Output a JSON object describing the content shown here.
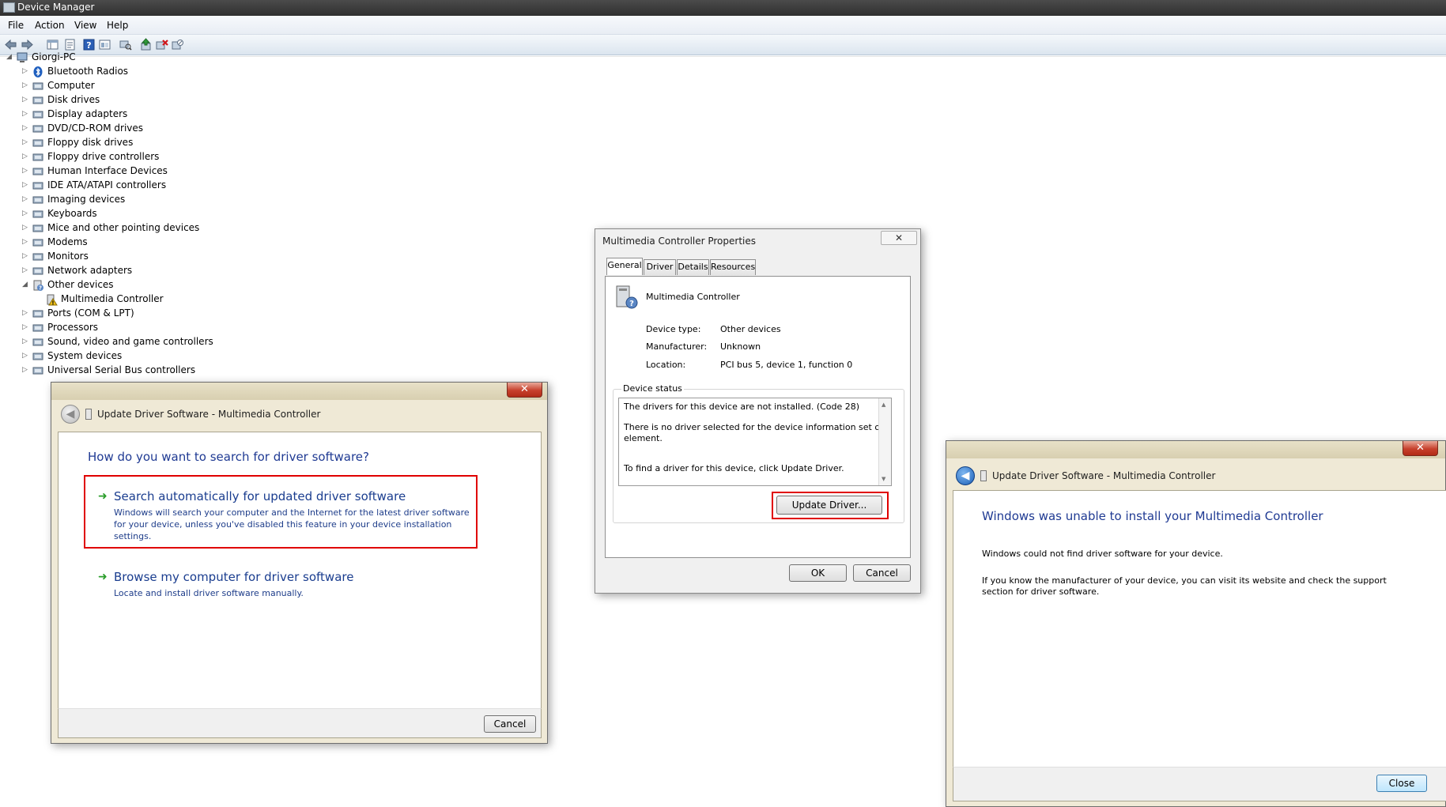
{
  "window": {
    "title": "Device Manager"
  },
  "menu": {
    "items": [
      "File",
      "Action",
      "View",
      "Help"
    ]
  },
  "toolbar": {
    "icons": [
      "back-arrow-icon",
      "forward-arrow-icon",
      "show-hide-console-tree-icon",
      "properties-icon",
      "help-icon",
      "console-view-icon",
      "scan-hardware-icon",
      "update-driver-icon",
      "uninstall-icon",
      "disable-icon"
    ]
  },
  "tree": {
    "root": "Giorgi-PC",
    "items": [
      {
        "label": "Bluetooth Radios",
        "icon": "bluetooth-icon"
      },
      {
        "label": "Computer",
        "icon": "computer-icon"
      },
      {
        "label": "Disk drives",
        "icon": "disk-drive-icon"
      },
      {
        "label": "Display adapters",
        "icon": "display-adapter-icon"
      },
      {
        "label": "DVD/CD-ROM drives",
        "icon": "dvd-drive-icon"
      },
      {
        "label": "Floppy disk drives",
        "icon": "floppy-disk-icon"
      },
      {
        "label": "Floppy drive controllers",
        "icon": "floppy-controller-icon"
      },
      {
        "label": "Human Interface Devices",
        "icon": "hid-icon"
      },
      {
        "label": "IDE ATA/ATAPI controllers",
        "icon": "ide-controller-icon"
      },
      {
        "label": "Imaging devices",
        "icon": "imaging-device-icon"
      },
      {
        "label": "Keyboards",
        "icon": "keyboard-icon"
      },
      {
        "label": "Mice and other pointing devices",
        "icon": "mouse-icon"
      },
      {
        "label": "Modems",
        "icon": "modem-icon"
      },
      {
        "label": "Monitors",
        "icon": "monitor-icon"
      },
      {
        "label": "Network adapters",
        "icon": "network-adapter-icon"
      },
      {
        "label": "Other devices",
        "icon": "other-devices-icon"
      },
      {
        "label": "Multimedia Controller",
        "icon": "unknown-device-warning-icon"
      },
      {
        "label": "Ports (COM & LPT)",
        "icon": "port-icon"
      },
      {
        "label": "Processors",
        "icon": "processor-icon"
      },
      {
        "label": "Sound, video and game controllers",
        "icon": "sound-icon"
      },
      {
        "label": "System devices",
        "icon": "system-device-icon"
      },
      {
        "label": "Universal Serial Bus controllers",
        "icon": "usb-icon"
      }
    ]
  },
  "update_dialog_left": {
    "title": "Update Driver Software - Multimedia Controller",
    "heading": "How do you want to search for driver software?",
    "option1_title": "Search automatically for updated driver software",
    "option1_desc_1": "Windows will search your computer and the Internet for the latest driver software",
    "option1_desc_2": "for your device, unless you've disabled this feature in your device installation",
    "option1_desc_3": "settings.",
    "option2_title": "Browse my computer for driver software",
    "option2_desc": "Locate and install driver software manually.",
    "cancel": "Cancel"
  },
  "properties_dialog": {
    "title": "Multimedia Controller Properties",
    "tabs": [
      "General",
      "Driver",
      "Details",
      "Resources"
    ],
    "device_name": "Multimedia Controller",
    "device_type_label": "Device type:",
    "device_type_value": "Other devices",
    "manufacturer_label": "Manufacturer:",
    "manufacturer_value": "Unknown",
    "location_label": "Location:",
    "location_value": "PCI bus 5, device 1, function 0",
    "status_group": "Device status",
    "status_line1": "The drivers for this device are not installed. (Code 28)",
    "status_line2": "There is no driver selected for the device information set or",
    "status_line3": "element.",
    "status_line4": "To find a driver for this device, click Update Driver.",
    "update_driver": "Update Driver...",
    "ok": "OK",
    "cancel": "Cancel"
  },
  "update_dialog_right": {
    "title": "Update Driver Software - Multimedia Controller",
    "heading": "Windows was unable to install your Multimedia Controller",
    "line1": "Windows could not find driver software for your device.",
    "line2": "If you know the manufacturer of your device, you can visit its website and check the support",
    "line3": "section for driver software.",
    "close": "Close"
  }
}
